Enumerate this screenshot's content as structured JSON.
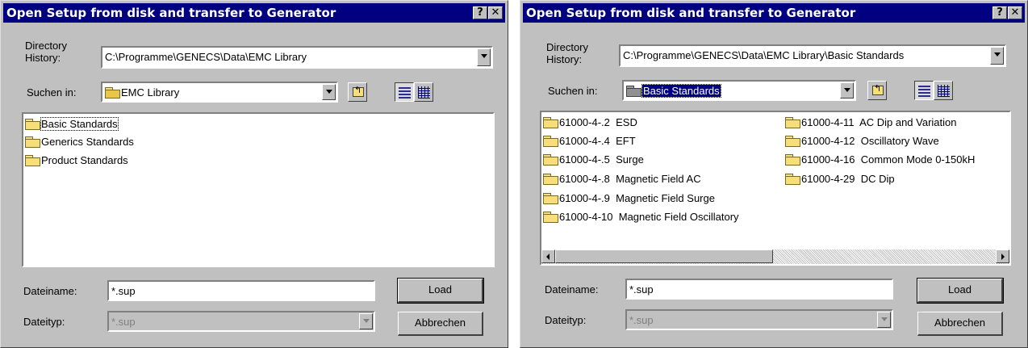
{
  "dialogs": [
    {
      "title": "Open Setup from disk and transfer to Generator",
      "help_glyph": "?",
      "close_glyph": "✕",
      "directory_history_label_line1": "Directory",
      "directory_history_label_line2": "History:",
      "directory_history_value": "C:\\Programme\\GENECS\\Data\\EMC Library",
      "look_in_label": "Suchen in:",
      "look_in_value": "EMC Library",
      "items": [
        "Basic Standards",
        "Generics Standards",
        "Product Standards"
      ],
      "filename_label": "Dateiname:",
      "filename_value": "*.sup",
      "filetype_label": "Dateityp:",
      "filetype_value": "*.sup",
      "load_label": "Load",
      "cancel_label": "Abbrechen"
    },
    {
      "title": "Open Setup from disk and transfer to Generator",
      "help_glyph": "?",
      "close_glyph": "✕",
      "directory_history_label_line1": "Directory",
      "directory_history_label_line2": "History:",
      "directory_history_value": "C:\\Programme\\GENECS\\Data\\EMC Library\\Basic Standards",
      "look_in_label": "Suchen in:",
      "look_in_value": "Basic Standards",
      "items_col1": [
        {
          "code": "61000-4-.2",
          "name": "ESD"
        },
        {
          "code": "61000-4-.4",
          "name": "EFT"
        },
        {
          "code": "61000-4-.5",
          "name": "Surge"
        },
        {
          "code": "61000-4-.8",
          "name": "Magnetic Field AC"
        },
        {
          "code": "61000-4-.9",
          "name": "Magnetic Field Surge"
        },
        {
          "code": "61000-4-10",
          "name": "Magnetic Field Oscillatory"
        }
      ],
      "items_col2": [
        {
          "code": "61000-4-11",
          "name": "AC Dip and Variation"
        },
        {
          "code": "61000-4-12",
          "name": "Oscillatory Wave"
        },
        {
          "code": "61000-4-16",
          "name": "Common Mode 0-150kH"
        },
        {
          "code": "61000-4-29",
          "name": "DC Dip"
        }
      ],
      "filename_label": "Dateiname:",
      "filename_value": "*.sup",
      "filetype_label": "Dateityp:",
      "filetype_value": "*.sup",
      "load_label": "Load",
      "cancel_label": "Abbrechen"
    }
  ],
  "icons": {
    "folder": "folder-icon",
    "up_folder": "up-folder-icon",
    "list_view": "list-view-icon",
    "details_view": "details-view-icon"
  },
  "colors": {
    "title_bar": "#000080",
    "face": "#c0c0c0",
    "selection": "#000080"
  }
}
